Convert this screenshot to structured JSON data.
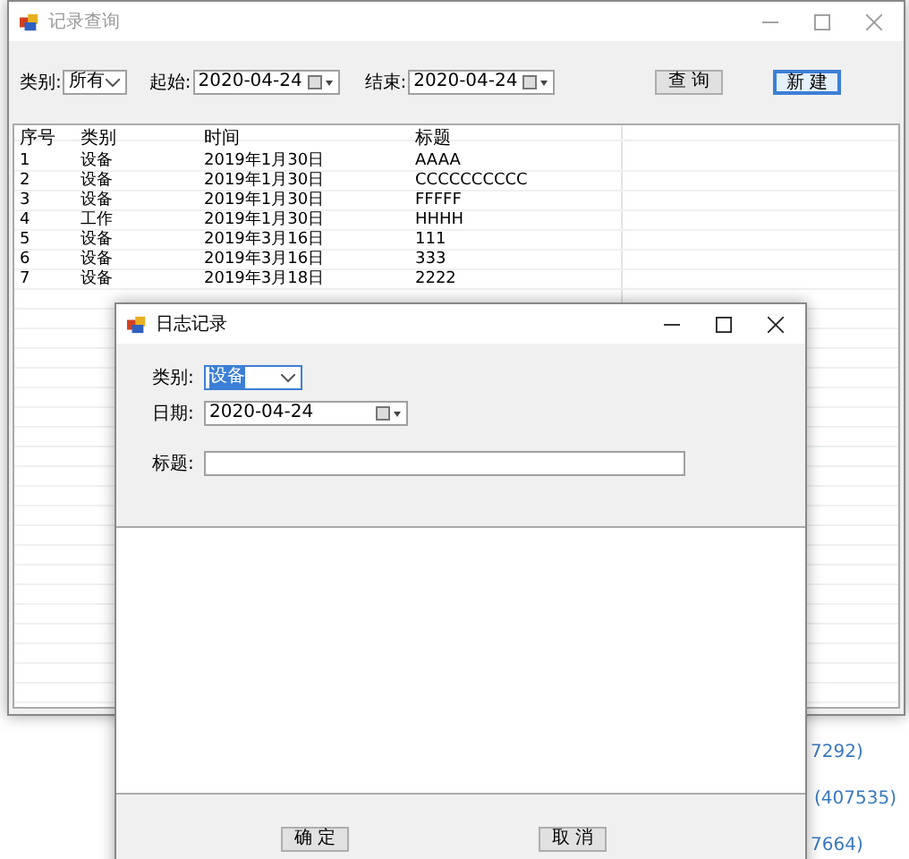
{
  "main_window": {
    "title": "记录查询",
    "toolbar": {
      "category_label": "类别:",
      "category_value": "所有",
      "start_label": "起始:",
      "start_date": "2020-04-24",
      "end_label": "结束:",
      "end_date": "2020-04-24",
      "buttons": [
        {
          "label": "查 询",
          "focused": false
        },
        {
          "label": "新 建",
          "focused": true
        }
      ]
    },
    "table": {
      "columns": [
        "序号",
        "类别",
        "时间",
        "标题"
      ],
      "rows": [
        [
          "1",
          "设备",
          "2019年1月30日",
          "AAAA"
        ],
        [
          "2",
          "设备",
          "2019年1月30日",
          "CCCCCCCCCC"
        ],
        [
          "3",
          "设备",
          "2019年1月30日",
          "FFFFF"
        ],
        [
          "4",
          "工作",
          "2019年1月30日",
          "HHHH"
        ],
        [
          "5",
          "设备",
          "2019年3月16日",
          "111"
        ],
        [
          "6",
          "设备",
          "2019年3月16日",
          "333"
        ],
        [
          "7",
          "设备",
          "2019年3月18日",
          "2222"
        ]
      ]
    }
  },
  "dialog": {
    "title": "日志记录",
    "category_label": "类别:",
    "category_value": "设备",
    "category_value_selected": true,
    "date_label": "日期:",
    "date_value": "2020-04-24",
    "title_label": "标题:",
    "buttons": [
      {
        "label": "确 定",
        "focused": false
      },
      {
        "label": "取 消",
        "focused": false
      }
    ]
  },
  "background_texts": [
    "7292)",
    "(407535)",
    "7664)"
  ]
}
